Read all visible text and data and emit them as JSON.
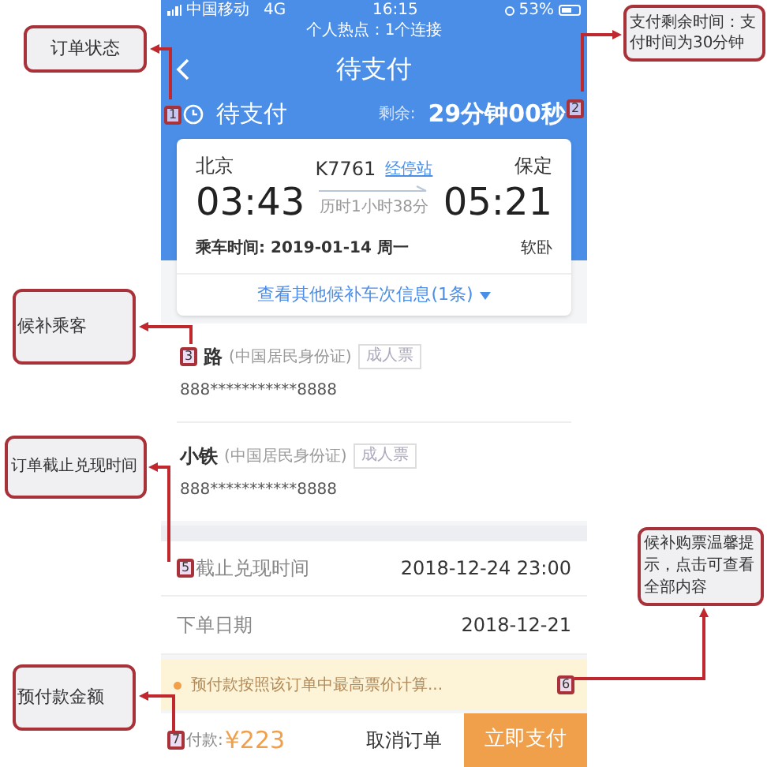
{
  "status_bar": {
    "carrier": "中国移动",
    "network": "4G",
    "time": "16:15",
    "battery": "53%"
  },
  "hotspot_banner": "个人热点：1个连接",
  "nav": {
    "title": "待支付"
  },
  "order_status": {
    "label": "待支付",
    "remaining_label": "剩余:",
    "remaining": "29分钟00秒"
  },
  "trip": {
    "from": "北京",
    "depart": "03:43",
    "train": "K7761",
    "stops_link": "经停站",
    "duration": "历时1小时38分",
    "to": "保定",
    "arrive": "05:21",
    "date": "乘车时间: 2019-01-14 周一",
    "seat": "软卧",
    "more": "查看其他候补车次信息(1条)"
  },
  "passengers": [
    {
      "name": "路",
      "id_type": "(中国居民身份证)",
      "ticket_type": "成人票",
      "id_number": "888***********8888"
    },
    {
      "name": "小铁",
      "id_type": "(中国居民身份证)",
      "ticket_type": "成人票",
      "id_number": "888***********8888"
    }
  ],
  "info_rows": [
    {
      "label": "截止兑现时间",
      "value": "2018-12-24 23:00"
    },
    {
      "label": "下单日期",
      "value": "2018-12-21"
    }
  ],
  "notice": "预付款按照该订单中最高票价计算...",
  "footer": {
    "prepay_label": "付款:",
    "amount": "¥223",
    "cancel": "取消订单",
    "pay": "立即支付"
  },
  "callouts": [
    {
      "text": "订单状态",
      "marker": "1"
    },
    {
      "text": "支付剩余时间：支付时间为30分钟",
      "marker": "2"
    },
    {
      "text": "候补乘客",
      "marker": "3"
    },
    {
      "text": "订单截止兑现时间",
      "marker": "5"
    },
    {
      "text": "候补购票温馨提示，点击可查看全部内容",
      "marker": "6"
    },
    {
      "text": "预付款金额",
      "marker": "7"
    }
  ]
}
